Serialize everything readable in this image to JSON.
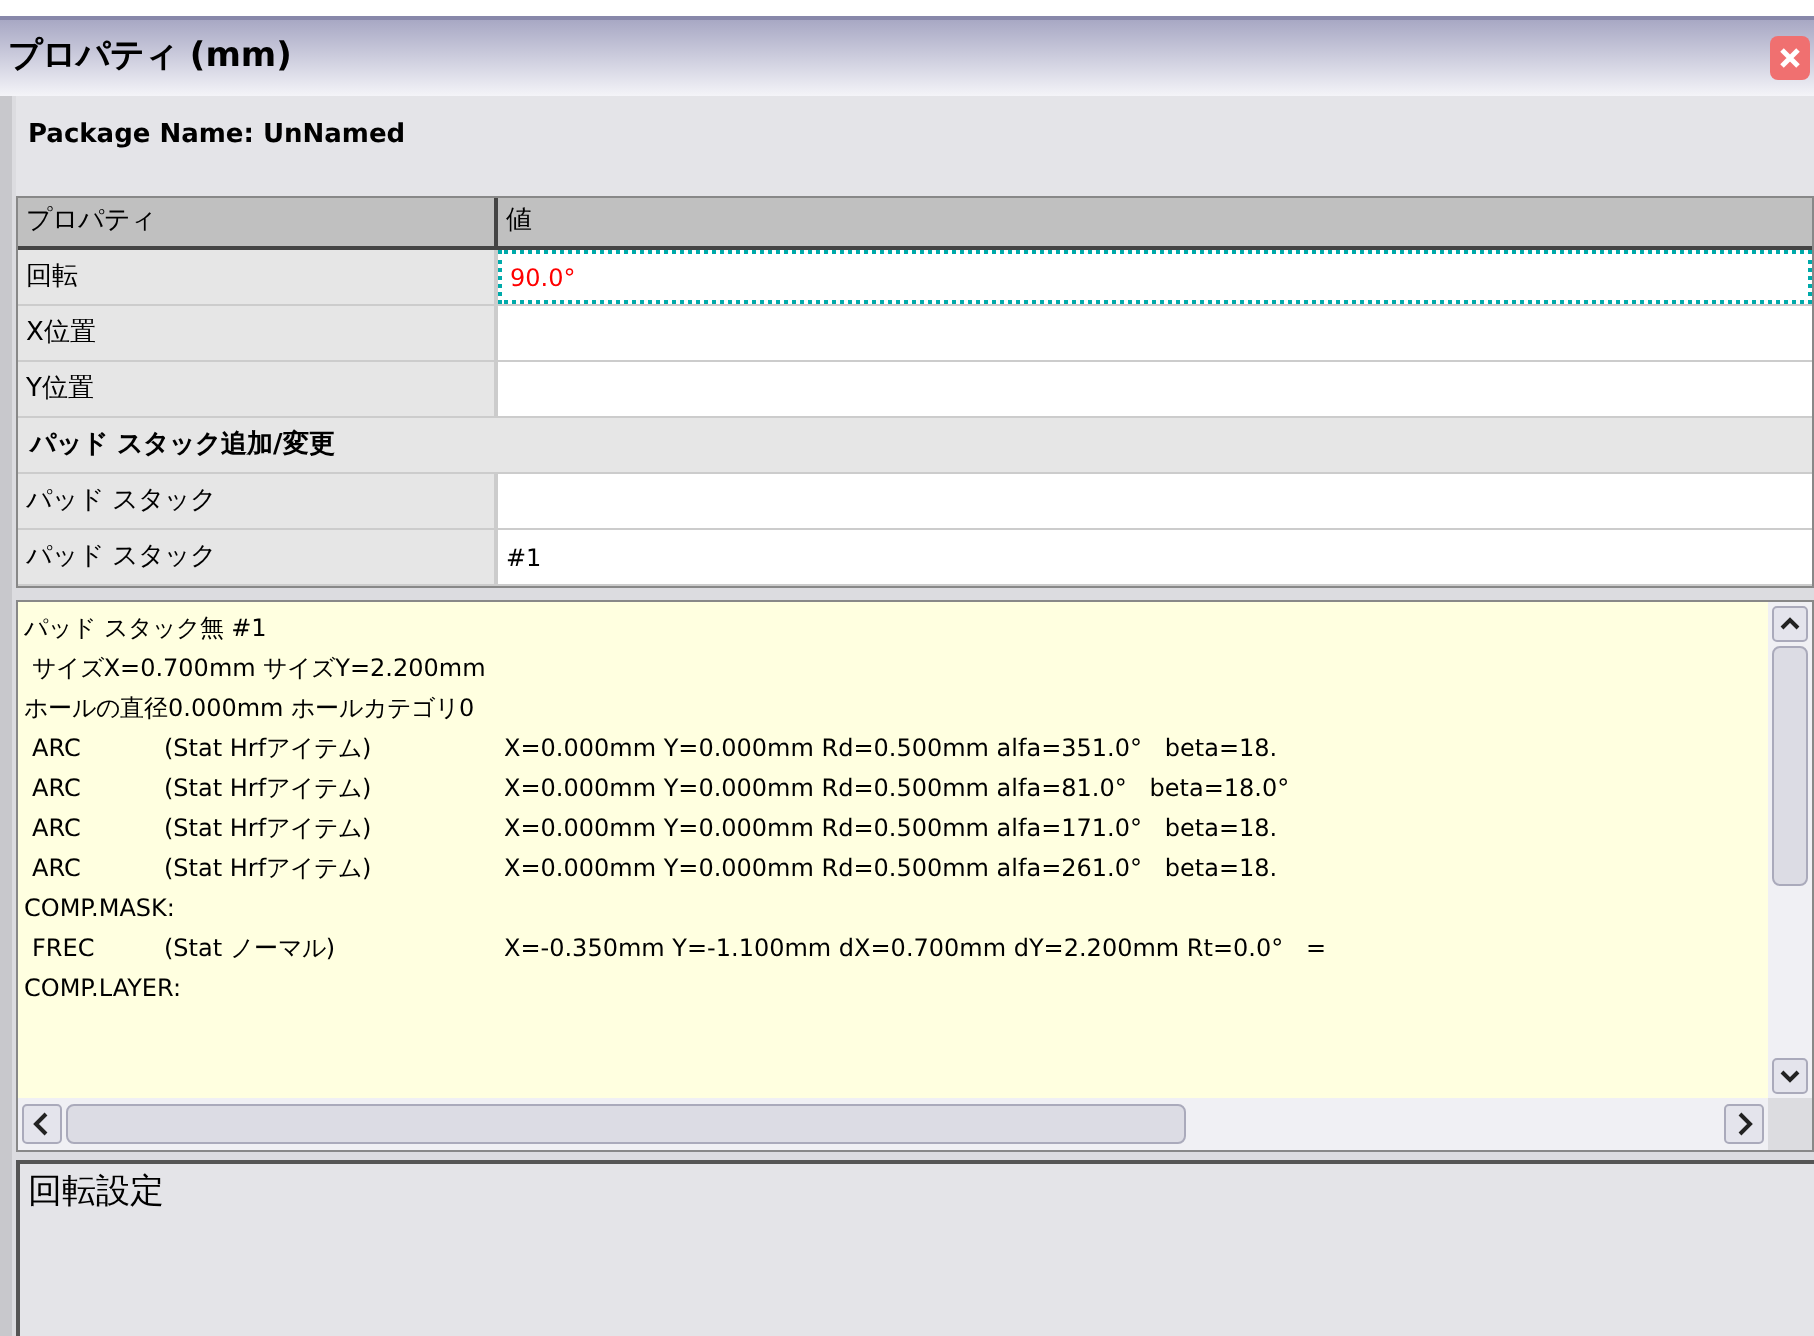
{
  "window": {
    "title": "プロパティ (mm)",
    "package_name": "Package Name: UnNamed"
  },
  "grid": {
    "columns": [
      "プロパティ",
      "値"
    ],
    "rows": [
      {
        "kind": "property",
        "label": "回転",
        "value": "90.0°",
        "selected": true
      },
      {
        "kind": "property",
        "label": "X位置",
        "value": "",
        "selected": false
      },
      {
        "kind": "property",
        "label": "Y位置",
        "value": "",
        "selected": false
      },
      {
        "kind": "group",
        "label": "パッド スタック追加/変更",
        "selected": false
      },
      {
        "kind": "property",
        "label": "パッド スタック",
        "value": "",
        "selected": false
      },
      {
        "kind": "property",
        "label": "パッド スタック",
        "value": "#1",
        "selected": false
      }
    ]
  },
  "details": {
    "lines": [
      {
        "kind": "text",
        "text": "パッド スタック無 #1"
      },
      {
        "kind": "text",
        "text": " サイズX=0.700mm サイズY=2.200mm"
      },
      {
        "kind": "text",
        "text": "ホールの直径0.000mm ホールカテゴリ0"
      },
      {
        "kind": "item",
        "type": "ARC",
        "status": "(Stat Hrfアイテム)",
        "params": "X=0.000mm Y=0.000mm Rd=0.500mm alfa=351.0°   beta=18."
      },
      {
        "kind": "item",
        "type": "ARC",
        "status": "(Stat Hrfアイテム)",
        "params": "X=0.000mm Y=0.000mm Rd=0.500mm alfa=81.0°   beta=18.0°"
      },
      {
        "kind": "item",
        "type": "ARC",
        "status": "(Stat Hrfアイテム)",
        "params": "X=0.000mm Y=0.000mm Rd=0.500mm alfa=171.0°   beta=18."
      },
      {
        "kind": "item",
        "type": "ARC",
        "status": "(Stat Hrfアイテム)",
        "params": "X=0.000mm Y=0.000mm Rd=0.500mm alfa=261.0°   beta=18."
      },
      {
        "kind": "text",
        "text": "COMP.MASK:"
      },
      {
        "kind": "item",
        "type": "FREC",
        "status": "(Stat ノーマル)",
        "params": "X=-0.350mm Y=-1.100mm dX=0.700mm dY=2.200mm Rt=0.0°   ="
      },
      {
        "kind": "text",
        "text": "COMP.LAYER:"
      }
    ]
  },
  "description": "回転設定"
}
